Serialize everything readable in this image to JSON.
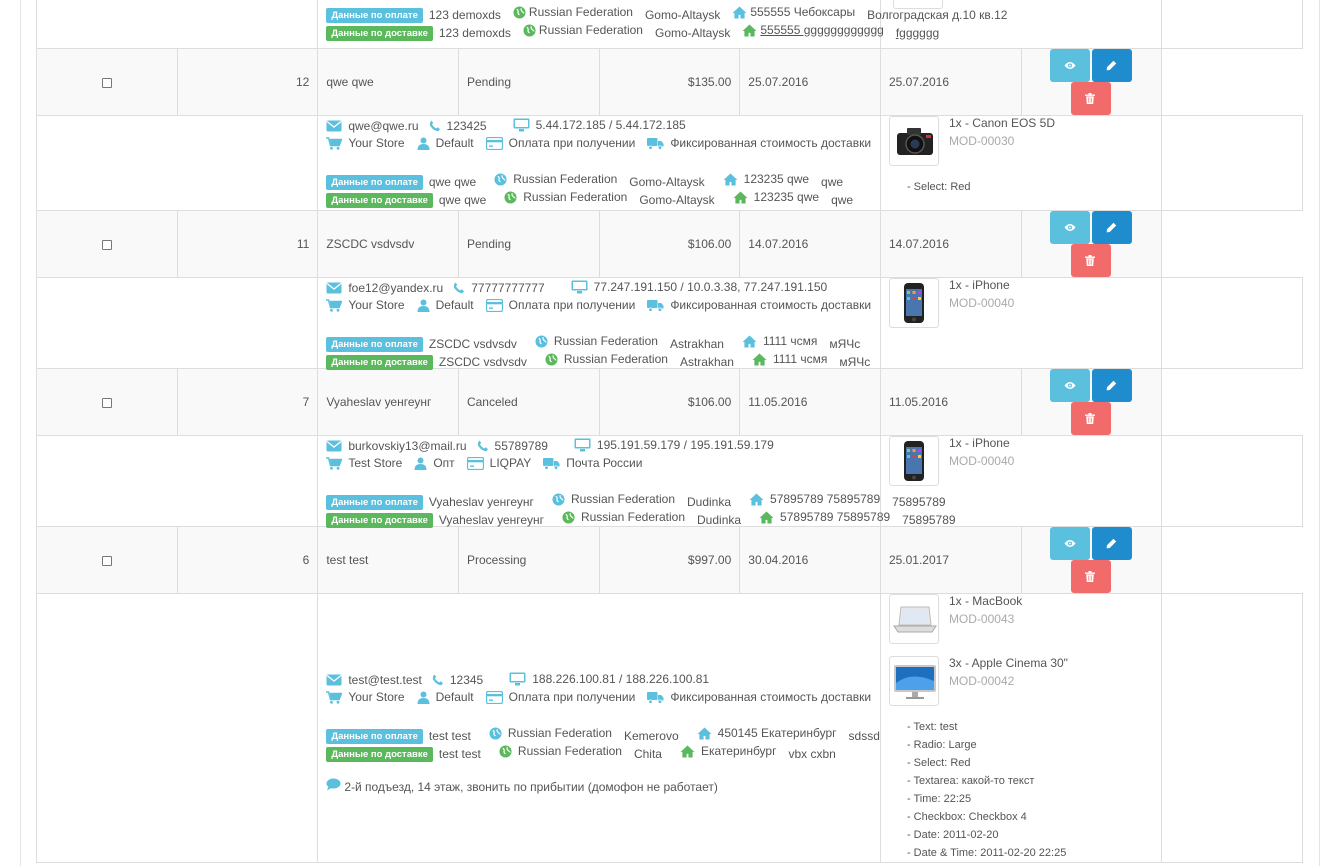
{
  "top": {
    "pay_name": "123 demoxds",
    "pay_country": "Russian Federation",
    "pay_city": "Gomo-Altaysk",
    "pay_addr": "555555 Чебоксары",
    "pay_extra": "Волгоградская д.10 кв.12",
    "ship_name": "123 demoxds",
    "ship_country": "Russian Federation",
    "ship_city": "Gomo-Altaysk",
    "ship_addr": "555555 gggggggggggg",
    "ship_extra": "fgggggg"
  },
  "labels": {
    "payment_badge": "Данные по оплате",
    "shipping_badge": "Данные по доставке"
  },
  "orders": [
    {
      "id": "12",
      "customer": "qwe qwe",
      "status": "Pending",
      "total": "$135.00",
      "date_added": "25.07.2016",
      "date_modified": "25.07.2016",
      "email": "qwe@qwe.ru",
      "phone": "123425",
      "ip": "5.44.172.185 / 5.44.172.185",
      "store": "Your Store",
      "group": "Default",
      "payment": "Оплата при получении",
      "shipping": "Фиксированная стоимость доставки",
      "pay": {
        "name": "qwe qwe",
        "country": "Russian Federation",
        "city": "Gomo-Altaysk",
        "addr": "123235 qwe",
        "extra": "qwe"
      },
      "ship": {
        "name": "qwe qwe",
        "country": "Russian Federation",
        "city": "Gomo-Altaysk",
        "addr": "123235 qwe",
        "extra": "qwe"
      },
      "products": [
        {
          "name": "1x - Canon EOS 5D",
          "model": "MOD-00030",
          "options": [
            "- Select: Red"
          ]
        }
      ]
    },
    {
      "id": "11",
      "customer": "ZSCDC vsdvsdv",
      "status": "Pending",
      "total": "$106.00",
      "date_added": "14.07.2016",
      "date_modified": "14.07.2016",
      "email": "foe12@yandex.ru",
      "phone": "77777777777",
      "ip": "77.247.191.150 / 10.0.3.38, 77.247.191.150",
      "store": "Your Store",
      "group": "Default",
      "payment": "Оплата при получении",
      "shipping": "Фиксированная стоимость доставки",
      "pay": {
        "name": "ZSCDC vsdvsdv",
        "country": "Russian Federation",
        "city": "Astrakhan",
        "addr": "1111 чсмя",
        "extra": "мЯЧс"
      },
      "ship": {
        "name": "ZSCDC vsdvsdv",
        "country": "Russian Federation",
        "city": "Astrakhan",
        "addr": "1111 чсмя",
        "extra": "мЯЧс"
      },
      "products": [
        {
          "name": "1x - iPhone",
          "model": "MOD-00040",
          "options": []
        }
      ]
    },
    {
      "id": "7",
      "customer": "Vyaheslav уенгеунг",
      "status": "Canceled",
      "total": "$106.00",
      "date_added": "11.05.2016",
      "date_modified": "11.05.2016",
      "email": "burkovskiy13@mail.ru",
      "phone": "55789789",
      "ip": "195.191.59.179 / 195.191.59.179",
      "store": "Test Store",
      "group": "Опт",
      "payment": "LIQPAY",
      "shipping": "Почта России",
      "pay": {
        "name": "Vyaheslav уенгеунг",
        "country": "Russian Federation",
        "city": "Dudinka",
        "addr": "57895789 75895789",
        "extra": "75895789"
      },
      "ship": {
        "name": "Vyaheslav уенгеунг",
        "country": "Russian Federation",
        "city": "Dudinka",
        "addr": "57895789 75895789",
        "extra": "75895789"
      },
      "products": [
        {
          "name": "1x - iPhone",
          "model": "MOD-00040",
          "options": []
        }
      ]
    },
    {
      "id": "6",
      "customer": "test test",
      "status": "Processing",
      "total": "$997.00",
      "date_added": "30.04.2016",
      "date_modified": "25.01.2017",
      "email": "test@test.test",
      "phone": "12345",
      "ip": "188.226.100.81 / 188.226.100.81",
      "store": "Your Store",
      "group": "Default",
      "payment": "Оплата при получении",
      "shipping": "Фиксированная стоимость доставки",
      "pay": {
        "name": "test test",
        "country": "Russian Federation",
        "city": "Kemerovo",
        "addr": "450145 Екатеринбург",
        "extra": "sdssd"
      },
      "ship": {
        "name": "test test",
        "country": "Russian Federation",
        "city": "Chita",
        "addr": "Екатеринбург",
        "extra": "vbx cxbn"
      },
      "comment": "2-й подъезд, 14 этаж, звонить по прибытии (домофон не работает)",
      "products": [
        {
          "name": "1x - MacBook",
          "model": "MOD-00043",
          "options": []
        },
        {
          "name": "3x - Apple Cinema 30\"",
          "model": "MOD-00042",
          "options": [
            "- Text: test",
            "- Radio: Large",
            "- Select: Red",
            "- Textarea: какой-то текст",
            "- Time: 22:25",
            "- Checkbox: Checkbox 4",
            "- Date: 2011-02-20",
            "- Date & Time: 2011-02-20 22:25"
          ]
        }
      ]
    }
  ]
}
